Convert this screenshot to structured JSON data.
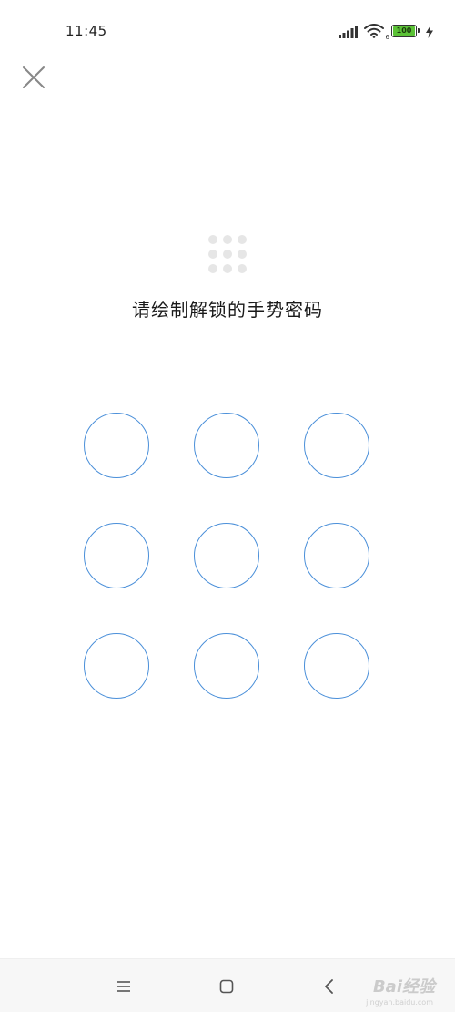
{
  "status_bar": {
    "time": "11:45",
    "wifi_label": "6",
    "battery_level": "100",
    "icons": [
      "signal-icon",
      "wifi-icon",
      "battery-icon",
      "charging-icon"
    ]
  },
  "header": {
    "close_icon": "close-icon"
  },
  "prompt": {
    "title": "请绘制解锁的手势密码",
    "mini_pattern_icon": "pattern-grid-icon"
  },
  "pattern": {
    "rows": 3,
    "cols": 3,
    "node_color": "#4a8fd9"
  },
  "nav_bar": {
    "menu_icon": "menu-icon",
    "home_icon": "home-icon",
    "back_icon": "back-icon"
  },
  "watermark": {
    "text": "Bai经验",
    "sub": "jingyan.baidu.com"
  }
}
